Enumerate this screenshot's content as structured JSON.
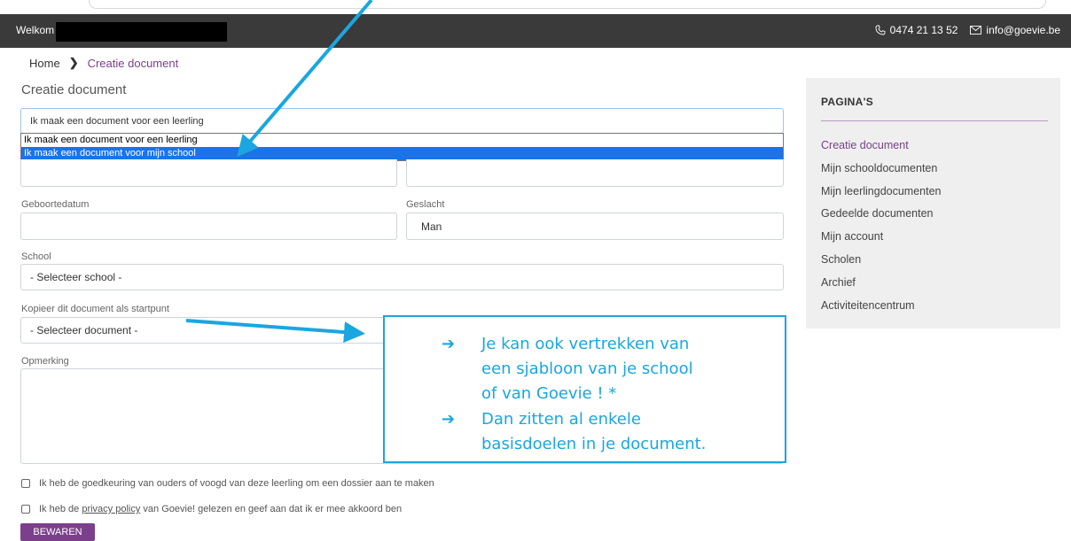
{
  "topbar": {
    "welcome": "Welkom",
    "phone": "0474 21 13 52",
    "email": "info@goevie.be"
  },
  "breadcrumb": {
    "home": "Home",
    "separator": "❯",
    "current": "Creatie document"
  },
  "page_title": "Creatie document",
  "form": {
    "type_select_value": "Ik maak een document voor een leerling",
    "type_options": [
      "Ik maak een document voor een leerling",
      "Ik maak een document voor mijn school"
    ],
    "birthdate_label": "Geboortedatum",
    "gender_label": "Geslacht",
    "gender_value": "Man",
    "school_label": "School",
    "school_value": "- Selecteer school -",
    "copy_label": "Kopieer dit document als startpunt",
    "copy_value": "- Selecteer document -",
    "remark_label": "Opmerking",
    "consent_text": "Ik heb de goedkeuring van ouders of voogd van deze leerling om een dossier aan te maken",
    "privacy_before": "Ik heb de ",
    "privacy_link": "privacy policy",
    "privacy_after": " van Goevie! gelezen en geef aan dat ik er mee akkoord ben",
    "submit_label": "BEWAREN"
  },
  "sidebar": {
    "heading": "PAGINA'S",
    "items": [
      "Creatie document",
      "Mijn schooldocumenten",
      "Mijn leerlingdocumenten",
      "Gedeelde documenten",
      "Mijn account",
      "Scholen",
      "Archief",
      "Activiteitencentrum"
    ]
  },
  "callout": {
    "arrow": "➔",
    "lines": [
      "Je kan ook vertrekken van",
      "een sjabloon van je school",
      "of van Goevie ! *",
      "Dan zitten al enkele",
      "basisdoelen in je document."
    ]
  },
  "colors": {
    "accent": "#7b3f8c",
    "annotation": "#1aa6e0",
    "topbar": "#3a3a3a",
    "selected_option": "#1a73e8"
  }
}
